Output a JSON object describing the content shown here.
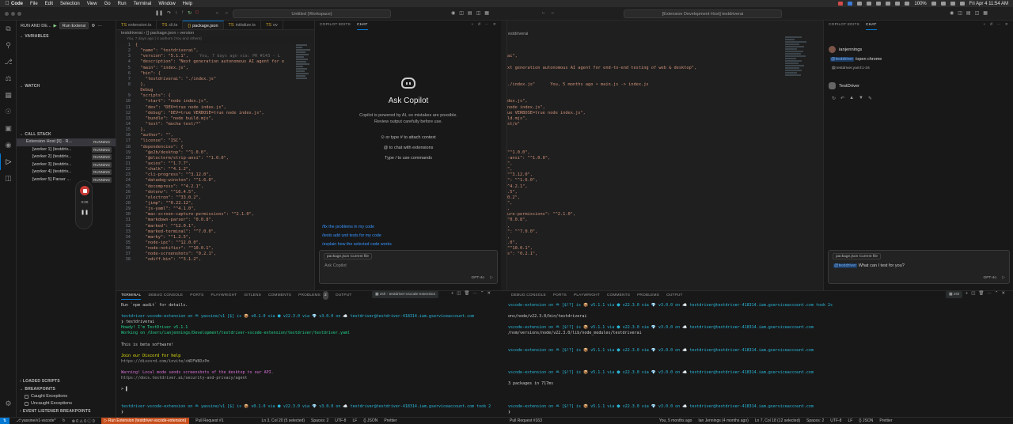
{
  "menubar": {
    "items": [
      "Code",
      "File",
      "Edit",
      "Selection",
      "View",
      "Go",
      "Run",
      "Terminal",
      "Window",
      "Help"
    ],
    "battery": "100%",
    "datetime": "Fri Apr 4  11:54 AM"
  },
  "window1": {
    "search": "Untitled (Workspace)",
    "sidebar": {
      "run_title": "RUN AND DE...",
      "run_config": "Run Extensi",
      "variables": "VARIABLES",
      "watch": "WATCH",
      "call_stack": "CALL STACK",
      "stack_rows": [
        {
          "label": "Extension Host [0] · R...",
          "status": "RUNNING"
        },
        {
          "label": "[worker 1] (testdriv...",
          "status": "RUNNING"
        },
        {
          "label": "[worker 2] (testdriv...",
          "status": "RUNNING"
        },
        {
          "label": "[worker 3] (testdriv...",
          "status": "RUNNING"
        },
        {
          "label": "[worker 4] (testdriv...",
          "status": "RUNNING"
        },
        {
          "label": "[worker 5] Parser ...",
          "status": "RUNNING"
        }
      ],
      "loaded_scripts": "LOADED SCRIPTS",
      "breakpoints": "BREAKPOINTS",
      "bp_caught": "Caught Exceptions",
      "bp_uncaught": "Uncaught Exceptions",
      "event_bp": "EVENT LISTENER BREAKPOINTS"
    },
    "recorder": {
      "time": "0:00"
    },
    "tabs": [
      {
        "label": "extension.ts",
        "active": false
      },
      {
        "label": "cli.ts",
        "active": false
      },
      {
        "label": "package.json",
        "active": true
      },
      {
        "label": "initialize.ts",
        "active": false
      },
      {
        "label": "ov",
        "active": false
      }
    ],
    "breadcrumb": "testdriverai › {} package.json › version",
    "blame": "You, 7 days ago | 4 authors (You and others)",
    "inline_blame": "You, 7 days ago via: PR #143 - L",
    "code_lines": [
      {
        "n": "1",
        "t": "{"
      },
      {
        "n": "2",
        "t": "  \"name\": \"testdriverai\","
      },
      {
        "n": "3",
        "t": "  \"version\": \"5.1.1\","
      },
      {
        "n": "4",
        "t": "  \"description\": \"Next generation autonomous AI agent for e"
      },
      {
        "n": "5",
        "t": "  \"main\": \"index.js\","
      },
      {
        "n": "6",
        "t": "  \"bin\": {"
      },
      {
        "n": "7",
        "t": "    \"testdriverai\": \"./index.js\""
      },
      {
        "n": "8",
        "t": "  },"
      },
      {
        "n": "",
        "t": "  Debug"
      },
      {
        "n": "9",
        "t": "  \"scripts\": {"
      },
      {
        "n": "10",
        "t": "    \"start\": \"node index.js\","
      },
      {
        "n": "11",
        "t": "    \"dev\": \"DEV=true node index.js\","
      },
      {
        "n": "12",
        "t": "    \"debug\": \"DEV=true VERBOSE=true node index.js\","
      },
      {
        "n": "13",
        "t": "    \"bundle\": \"node build.mjs\","
      },
      {
        "n": "14",
        "t": "    \"test\": \"mocha test/*\""
      },
      {
        "n": "15",
        "t": "  },"
      },
      {
        "n": "16",
        "t": "  \"author\": \"\","
      },
      {
        "n": "17",
        "t": "  \"license\": \"ISC\","
      },
      {
        "n": "18",
        "t": "  \"dependencies\": {"
      },
      {
        "n": "19",
        "t": "    \"@e2b/desktop\": \"^1.0.0\","
      },
      {
        "n": "20",
        "t": "    \"@electerm/strip-ansi\": \"^1.0.0\","
      },
      {
        "n": "21",
        "t": "    \"axios\": \"^1.7.7\","
      },
      {
        "n": "22",
        "t": "    \"chalk\": \"^4.1.2\","
      },
      {
        "n": "23",
        "t": "    \"cli-progress\": \"^3.12.0\","
      },
      {
        "n": "24",
        "t": "    \"datadog-winston\": \"^1.6.0\","
      },
      {
        "n": "25",
        "t": "    \"decompress\": \"^4.2.1\","
      },
      {
        "n": "26",
        "t": "    \"dotenv\": \"^16.4.5\","
      },
      {
        "n": "27",
        "t": "    \"electron\": \"^33.0.2\","
      },
      {
        "n": "28",
        "t": "    \"jimp\": \"^0.22.12\","
      },
      {
        "n": "29",
        "t": "    \"js-yaml\": \"^4.1.0\","
      },
      {
        "n": "30",
        "t": "    \"mac-screen-capture-permissions\": \"^2.1.0\","
      },
      {
        "n": "31",
        "t": "    \"markdown-parser\": \"0.0.8\","
      },
      {
        "n": "32",
        "t": "    \"marked\": \"^12.0.1\","
      },
      {
        "n": "33",
        "t": "    \"marked-terminal\": \"^7.0.0\","
      },
      {
        "n": "34",
        "t": "    \"marky\": \"^1.2.5\","
      },
      {
        "n": "35",
        "t": "    \"node-ipc\": \"^12.0.0\","
      },
      {
        "n": "36",
        "t": "    \"node-notifier\": \"^10.0.1\","
      },
      {
        "n": "37",
        "t": "    \"node-screenshots\": \"0.2.1\","
      },
      {
        "n": "38",
        "t": "    \"odiff-bin\": \"^3.1.2\","
      }
    ],
    "copilot": {
      "tab_edits": "COPILOT EDITS",
      "tab_chat": "CHAT",
      "title": "Ask Copilot",
      "desc1": "Copilot is powered by AI, so mistakes are possible.",
      "desc2": "Review output carefully before use.",
      "hint1": "or type # to attach context",
      "hint2": "to chat with extensions",
      "hint3": "Type / to use commands",
      "suggestions": [
        "/fix the problems in my code",
        "/tests add unit tests for my code",
        "/explain how the selected code works"
      ],
      "context": "package.json  Current file",
      "placeholder": "Ask Copilot",
      "model": "GPT-4o"
    },
    "panel_tabs": [
      "TERMINAL",
      "DEBUG CONSOLE",
      "PORTS",
      "PLAYWRIGHT",
      "GITLENS",
      "COMMENTS",
      "PROBLEMS",
      "OUTPUT"
    ],
    "problems_count": "2",
    "terminal_name": "zsh - testdriver-vscode-extension",
    "status": {
      "branch": "yassine/v1-vscode*",
      "counts": "⊗ 0 ⚠ 0 ⓘ 0",
      "run": "Run Extension (testdriver-vscode-extension)",
      "pr": "Pull Request #1",
      "cursor": "Ln 3, Col 20 (5 selected)",
      "spaces": "Spaces: 2",
      "enc": "UTF-8",
      "eol": "LF",
      "lang": "{} JSON",
      "prettier": "Prettier"
    }
  },
  "window2": {
    "search": "[Extension Development Host] testdriverai",
    "breadcrumb": "estdriverai",
    "code_lines": [
      {
        "n": "",
        "t": ""
      },
      {
        "n": "",
        "t": ""
      },
      {
        "n": "",
        "t": "ai\","
      },
      {
        "n": "",
        "t": ""
      },
      {
        "n": "",
        "t": "xt generation autonomous AI agent for end-to-end testing of web & desktop\","
      },
      {
        "n": "",
        "t": ""
      },
      {
        "n": "",
        "t": ""
      },
      {
        "n": "",
        "t": "./index.js\"      You, 5 months ago • main.js -> index.js"
      },
      {
        "n": "",
        "t": ""
      },
      {
        "n": "",
        "t": ""
      },
      {
        "n": "",
        "t": "dex.js\","
      },
      {
        "n": "",
        "t": "node index.js\","
      },
      {
        "n": "",
        "t": "ue VERBOSE=true node index.js\","
      },
      {
        "n": "",
        "t": "ld.mjs\","
      },
      {
        "n": "",
        "t": "st/e\""
      },
      {
        "n": "",
        "t": ""
      },
      {
        "n": "",
        "t": ""
      },
      {
        "n": "",
        "t": ""
      },
      {
        "n": "",
        "t": ""
      },
      {
        "n": "",
        "t": "\"^1.0.0\","
      },
      {
        "n": "",
        "t": "-ansi\": \"^1.0.0\","
      },
      {
        "n": "",
        "t": "\","
      },
      {
        "n": "",
        "t": "\","
      },
      {
        "n": "",
        "t": "\"^3.12.0\","
      },
      {
        "n": "",
        "t": "\": \"^1.6.0\","
      },
      {
        "n": "",
        "t": "^4.2.1\","
      },
      {
        "n": "",
        "t": ".5\","
      },
      {
        "n": "",
        "t": "0.2\","
      },
      {
        "n": "",
        "t": "\","
      },
      {
        "n": "",
        "t": ","
      },
      {
        "n": "",
        "t": "ure-permissions\": \"^2.1.0\","
      },
      {
        "n": "",
        "t": "\"0.0.8\","
      },
      {
        "n": "",
        "t": ","
      },
      {
        "n": "",
        "t": "\": \"^7.0.0\","
      },
      {
        "n": "",
        "t": ","
      },
      {
        "n": "",
        "t": ".0\","
      },
      {
        "n": "",
        "t": "\"^10.0.1\","
      },
      {
        "n": "",
        "t": "s\": \"0.2.1\","
      },
      {
        "n": "",
        "t": ""
      }
    ],
    "copilot": {
      "tab_edits": "COPILOT EDITS",
      "tab_chat": "CHAT",
      "user": "ianjennings",
      "message_mention": "@testdriver",
      "message": "/open chrome",
      "ref": "testdriver.yaml:1-34",
      "bot": "TestDriver",
      "context": "package.json  Current file",
      "input_mention": "@testdriver",
      "input": "What can I test for you?",
      "model": "GPT-4o"
    },
    "panel_tabs": [
      "DEBUG CONSOLE",
      "PORTS",
      "PLAYWRIGHT",
      "COMMENTS",
      "PROBLEMS",
      "OUTPUT"
    ],
    "terminal_name": "zsh",
    "status": {
      "pr": "Pull Request #163",
      "blame": "You, 5 months ago",
      "author": "Ian Jennings (4 months ago)",
      "cursor": "Ln 7, Col 18 (12 selected)",
      "spaces": "Spaces: 2",
      "enc": "UTF-8",
      "eol": "LF",
      "lang": "{} JSON",
      "prettier": "Prettier"
    }
  },
  "terminal1": [
    "Run `npm audit` for details.",
    "",
    "testdriver-vscode-extension on ᚈ yassine/v1 [$] is 📦 v0.1.0 via ⬢ v22.3.0 via 💎 v3.0.0 on ☁️ testdriver@testdriver-418314.iam.gserviceaccount.com",
    "❯ testdriverai",
    "Howdy! I'm TestDriver v5.1.1",
    "Working on /Users/ianjennings/Development/testdriver-vscode-extension/testdriver/testdriver.yaml",
    "",
    "This is beta software!",
    "",
    "Join our Discord for help",
    "https://discord.com/invite/cWDFW8DzPm",
    "",
    "Warning! Local mode sends screenshots of the desktop to our API.",
    "https://docs.testdriver.ai/security-and-privacy/agent",
    "",
    "> ▌",
    "",
    "",
    "testdriver-vscode-extension on ᚈ yassine/v1 [$] is 📦 v0.1.0 via ⬢ v22.3.0 via 💎 v3.0.0 on ☁️ testdriver@testdriver-418314.iam.gserviceaccount.com took 2",
    "❯"
  ],
  "terminal2": [
    "vscode-extension on ᚈ [$!?] is 📦 v5.1.1 via ⬢ v22.3.0 via 💎 v3.0.0 on ☁️ testdriver@testdriver-418314.iam.gserviceaccount.com took 2s",
    "",
    "ons/node/v22.3.0/bin/testdriverai",
    "",
    "vscode-extension on ᚈ [$!?] is 📦 v5.1.1 via ⬢ v22.3.0 via 💎 v3.0.0 on ☁️ testdriver@testdriver-418314.iam.gserviceaccount.com",
    "/nvm/versions/node/v22.3.0/lib/node_modules/testdriverai",
    "",
    "",
    "vscode-extension on ᚈ [$!?] is 📦 v5.1.1 via ⬢ v22.3.0 via 💎 v3.0.0 on ☁️ testdriver@testdriver-418314.iam.gserviceaccount.com",
    "",
    "",
    "",
    "vscode-extension on ᚈ [$!?] is 📦 v5.1.1 via ⬢ v22.3.0 via 💎 v3.0.0 on ☁️ testdriver@testdriver-418314.iam.gserviceaccount.com",
    "",
    "3 packages in 717ms",
    "",
    "",
    "",
    "vscode-extension on ᚈ [$!?] is 📦 v5.1.1 via ⬢ v22.3.0 via 💎 v3.0.0 on ☁️ testdriver@testdriver-418314.iam.gserviceaccount.com",
    "❯"
  ]
}
